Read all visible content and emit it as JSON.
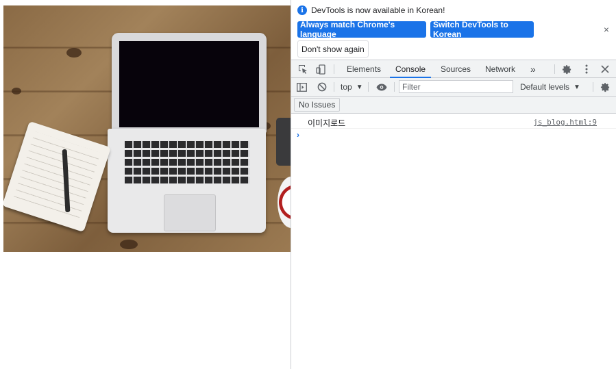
{
  "photo": {
    "alt": "laptop on wooden desk"
  },
  "devtools": {
    "infobar": {
      "message": "DevTools is now available in Korean!",
      "match_button": "Always match Chrome's language",
      "switch_button": "Switch DevTools to Korean",
      "dont_show": "Don't show again",
      "close": "×"
    },
    "tabs": {
      "elements": "Elements",
      "console": "Console",
      "sources": "Sources",
      "network": "Network",
      "more": "»"
    },
    "toolbar": {
      "context": "top",
      "filter_placeholder": "Filter",
      "levels": "Default levels"
    },
    "issues": {
      "label": "No Issues"
    },
    "console": {
      "messages": [
        {
          "text": "이미지로드",
          "source": "js_blog.html:9"
        }
      ],
      "prompt": "›"
    }
  },
  "colors": {
    "accent": "#1a73e8",
    "toolbar_bg": "#f1f3f4",
    "border": "#cacdd1"
  },
  "icons": [
    "info-icon",
    "inspect-icon",
    "device-toggle-icon",
    "gear-icon",
    "kebab-menu-icon",
    "close-icon",
    "sidebar-icon",
    "clear-console-icon",
    "eye-icon",
    "dropdown-arrow-icon"
  ]
}
